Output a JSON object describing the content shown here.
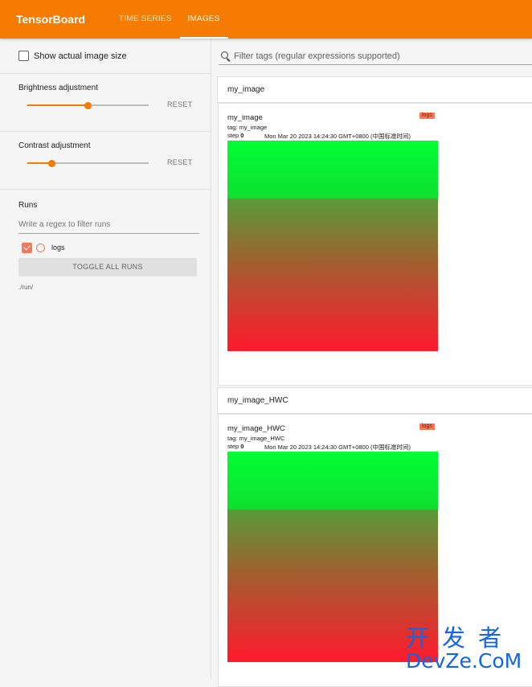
{
  "app": {
    "title": "TensorBoard"
  },
  "tabs": [
    {
      "label": "TIME SERIES",
      "active": false
    },
    {
      "label": "IMAGES",
      "active": true
    }
  ],
  "sidebar": {
    "show_actual_size": {
      "label": "Show actual image size",
      "checked": false
    },
    "brightness": {
      "label": "Brightness adjustment",
      "reset": "RESET",
      "value_fraction": 0.5
    },
    "contrast": {
      "label": "Contrast adjustment",
      "reset": "RESET",
      "value_fraction": 0.2
    },
    "runs": {
      "title": "Runs",
      "filter_placeholder": "Write a regex to filter runs",
      "items": [
        {
          "name": "logs",
          "checked": true,
          "color": "#f4795b"
        }
      ],
      "toggle_all": "TOGGLE ALL RUNS",
      "path": "./run/"
    }
  },
  "main": {
    "filter_placeholder": "Filter tags (regular expressions supported)",
    "groups": [
      {
        "header": "my_image",
        "card": {
          "title": "my_image",
          "run_badge": "logs",
          "tag": "tag: my_image",
          "step_label": "step",
          "step_value": "0",
          "date": "Mon Mar 20 2023 14:24:30 GMT+0800 (中国标准时间)"
        }
      },
      {
        "header": "my_image_HWC",
        "card": {
          "title": "my_image_HWC",
          "run_badge": "logs",
          "tag": "tag: my_image_HWC",
          "step_label": "step",
          "step_value": "0",
          "date": "Mon Mar 20 2023 14:24:30 GMT+0800 (中国标准时间)"
        }
      }
    ]
  },
  "watermark": {
    "line1": "开发者",
    "line2": "DevZe.CoM"
  },
  "colors": {
    "accent": "#f57c00",
    "run_color": "#f4795b"
  }
}
